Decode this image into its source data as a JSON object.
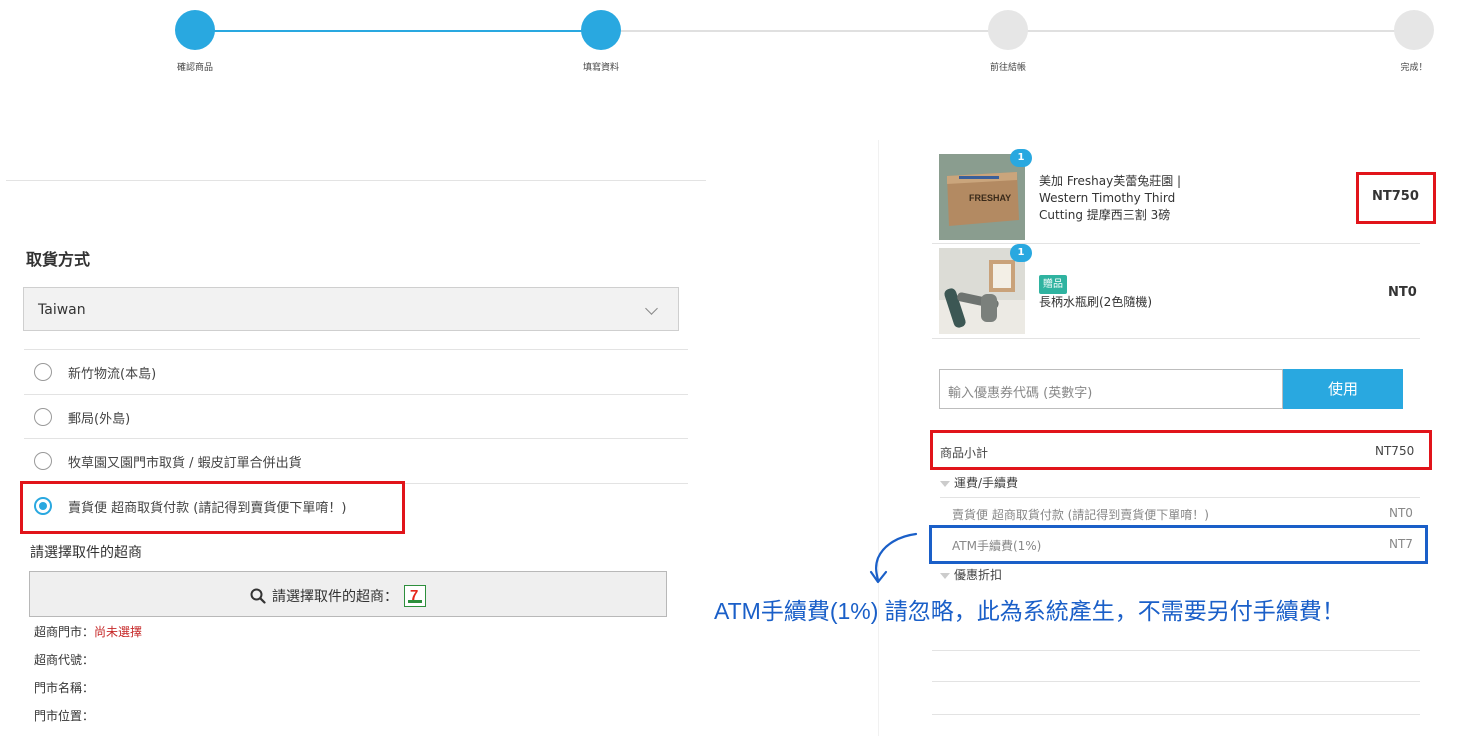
{
  "steps": [
    {
      "label": "確認商品",
      "done": true
    },
    {
      "label": "填寫資料",
      "done": true
    },
    {
      "label": "前往結帳",
      "done": false
    },
    {
      "label": "完成！",
      "done": false
    }
  ],
  "colors": {
    "accent": "#29a8e0",
    "annotation_red": "#e1141a",
    "annotation_blue": "#1a5fc8"
  },
  "shipping": {
    "title": "取貨方式",
    "country": "Taiwan",
    "options": [
      {
        "label": "新竹物流(本島)",
        "selected": false
      },
      {
        "label": "郵局(外島)",
        "selected": false
      },
      {
        "label": "牧草園又園門市取貨 / 蝦皮訂單合併出貨",
        "selected": false
      },
      {
        "label": "賣貨便 超商取貨付款 (請記得到賣貨便下單唷！)",
        "selected": true
      }
    ],
    "store_title": "請選擇取件的超商",
    "store_button": "請選擇取件的超商：",
    "store_icon_glyph": "7",
    "store_fields": {
      "store_label": "超商門市：",
      "store_value": "尚未選擇",
      "code_label": "超商代號：",
      "name_label": "門市名稱：",
      "location_label": "門市位置："
    }
  },
  "cart": {
    "items": [
      {
        "qty": "1",
        "name": "美加 Freshay芙蕾兔莊園 | Western Timothy Third Cutting 提摩西三割 3磅",
        "price": "NT750",
        "box_text": "FRESHAY",
        "tag": ""
      },
      {
        "qty": "1",
        "name": "長柄水瓶刷(2色隨機)",
        "price": "NT0",
        "tag": "贈品"
      }
    ],
    "coupon_placeholder": "輸入優惠券代碼 (英數字)",
    "coupon_button": "使用",
    "subtotal_label": "商品小計",
    "subtotal_value": "NT750",
    "shipping_header": "運費/手續費",
    "shipping_line_label": "賣貨便 超商取貨付款 (請記得到賣貨便下單唷！)",
    "shipping_line_value": "NT0",
    "atm_label": "ATM手續費(1%)",
    "atm_value": "NT7",
    "discount_header": "優惠折扣"
  },
  "annotation_note": "ATM手續費(1%) 請忽略，此為系統產生，不需要另付手續費！"
}
